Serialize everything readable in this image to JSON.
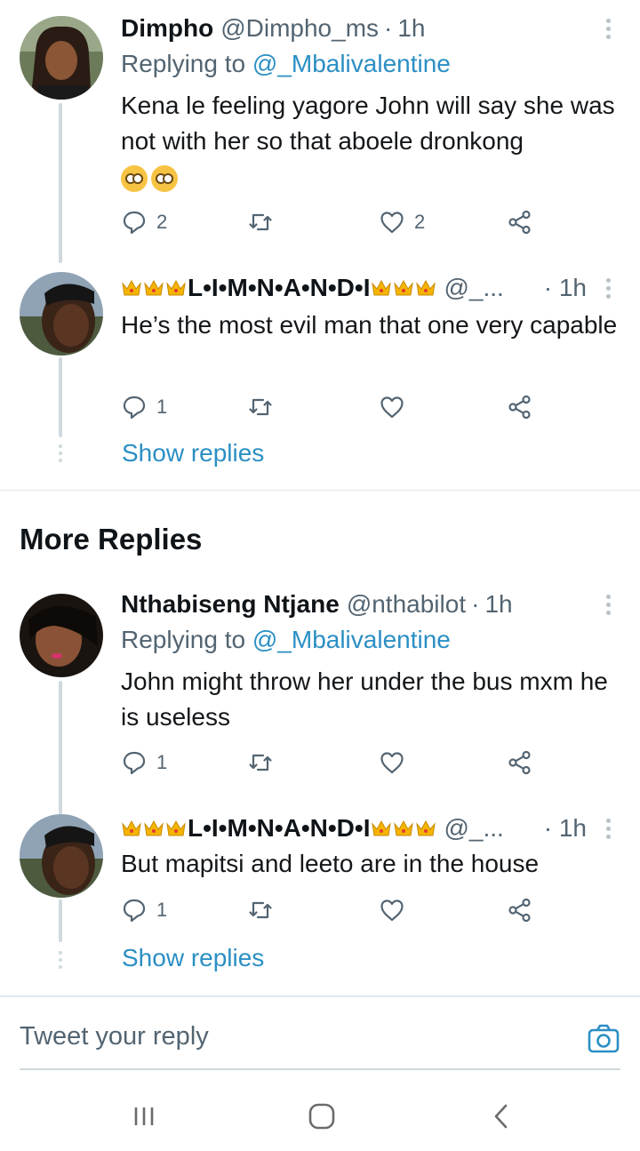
{
  "tweets": [
    {
      "name": "Dimpho",
      "handle": "@Dimpho_ms",
      "time": "1h",
      "replying_label": "Replying to",
      "replying_to": "@_Mbalivalentine",
      "text": "Kena le feeling yagore John will say she was not with her so that aboele dronkong",
      "emojis": [
        "pleading-face",
        "pleading-face"
      ],
      "reply_count": "2",
      "retweet_count": "",
      "like_count": "2"
    },
    {
      "name": "L•I•M•N•A•N•D•I",
      "handle": "@_...",
      "time": "1h",
      "text": "He’s the most evil man that one very capable",
      "reply_count": "1",
      "retweet_count": "",
      "like_count": ""
    },
    {
      "name": "Nthabiseng Ntjane",
      "handle": "@nthabilot",
      "time": "1h",
      "replying_label": "Replying to",
      "replying_to": "@_Mbalivalentine",
      "text": "John might throw her under the bus mxm he is useless",
      "reply_count": "1",
      "retweet_count": "",
      "like_count": ""
    },
    {
      "name": "L•I•M•N•A•N•D•I",
      "handle": "@_...",
      "time": "1h",
      "text": "But mapitsi and leeto are in the house",
      "reply_count": "1",
      "retweet_count": "",
      "like_count": ""
    }
  ],
  "show_replies_label": "Show replies",
  "section_title": "More Replies",
  "composer": {
    "placeholder": "Tweet your reply"
  },
  "colors": {
    "accent": "#2b8fc4",
    "secondary_text": "#536471",
    "divider": "#e1e8ed"
  },
  "icons": {
    "reply": "reply-icon",
    "retweet": "retweet-icon",
    "like": "heart-icon",
    "share": "share-icon",
    "more": "more-vertical-icon",
    "camera": "camera-icon",
    "nav_recent": "recent-apps-icon",
    "nav_home": "home-icon",
    "nav_back": "back-icon"
  }
}
